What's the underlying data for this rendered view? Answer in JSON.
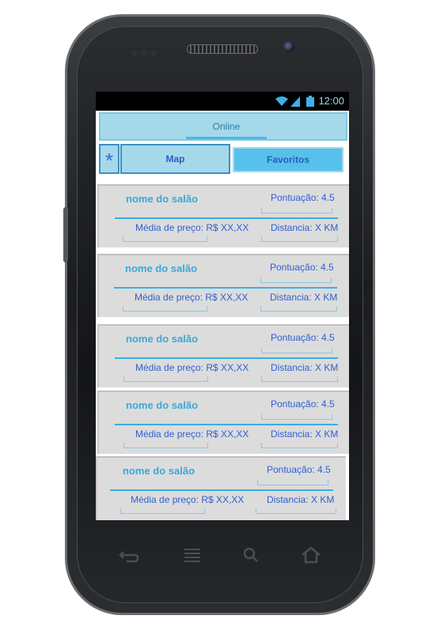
{
  "status_bar": {
    "time": "12:00"
  },
  "tabs": {
    "online": "Online"
  },
  "buttons": {
    "star": "*",
    "map": "Map",
    "favoritos": "Favoritos"
  },
  "salons": [
    {
      "name": "nome do salão",
      "score": "Pontuação: 4.5",
      "price": "Média de preço: R$ XX,XX",
      "distance": "Distancia: X KM"
    },
    {
      "name": "nome do salão",
      "score": "Pontuação: 4.5",
      "price": "Média de preço: R$ XX,XX",
      "distance": "Distancia: X KM"
    },
    {
      "name": "nome do salão",
      "score": "Pontuação: 4.5",
      "price": "Média de preço: R$ XX,XX",
      "distance": "Distancia: X KM"
    },
    {
      "name": "nome do salão",
      "score": "Pontuação: 4.5",
      "price": "Média de preço: R$ XX,XX",
      "distance": "Distancia: X KM"
    },
    {
      "name": "nome do salão",
      "score": "Pontuação: 4.5",
      "price": "Média de preço: R$ XX,XX",
      "distance": "Distancia: X KM"
    }
  ],
  "icons": [
    "wifi-icon",
    "signal-icon",
    "battery-icon",
    "back-icon",
    "menu-icon",
    "search-icon",
    "home-icon"
  ]
}
